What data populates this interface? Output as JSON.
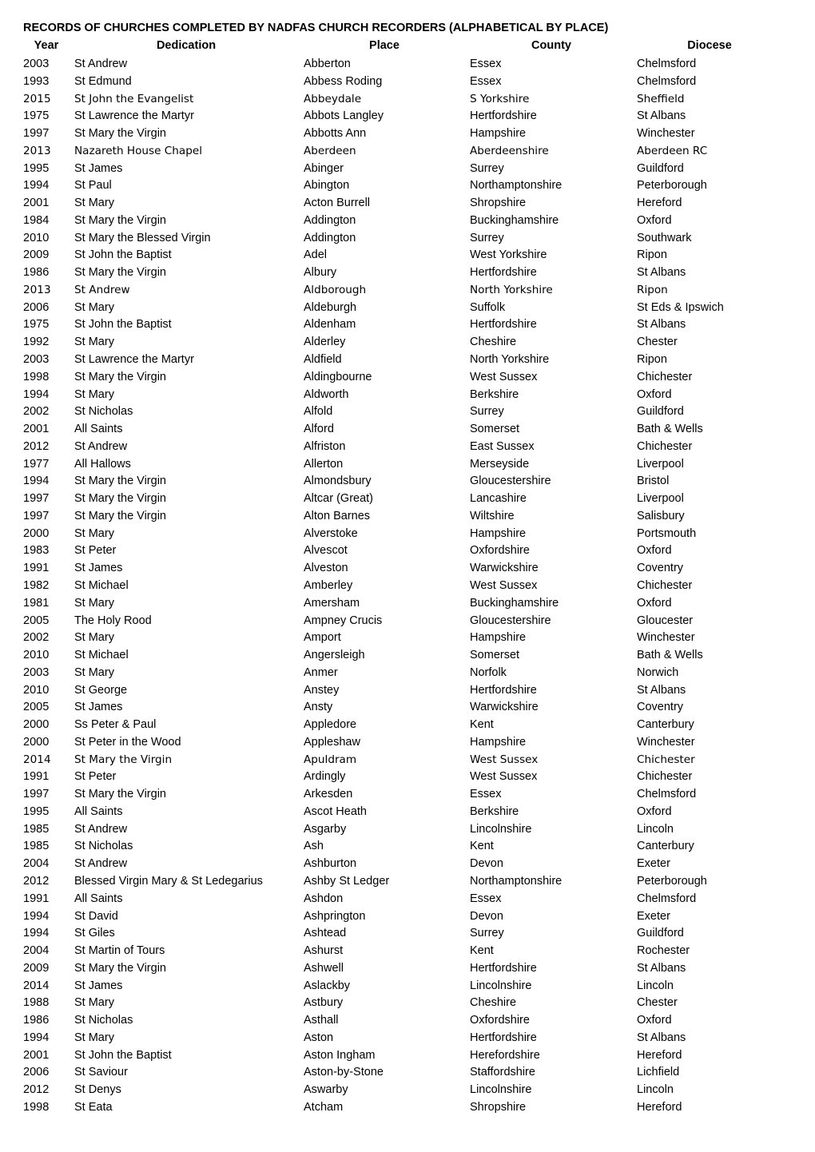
{
  "title": "RECORDS OF CHURCHES COMPLETED BY NADFAS CHURCH RECORDERS (ALPHABETICAL BY PLACE)",
  "columns": [
    "Year",
    "Dedication",
    "Place",
    "County",
    "Diocese"
  ],
  "rows": [
    {
      "year": "2003",
      "dedication": "St Andrew",
      "place": "Abberton",
      "county": "Essex",
      "diocese": "Chelmsford"
    },
    {
      "year": "1993",
      "dedication": "St Edmund",
      "place": "Abbess Roding",
      "county": "Essex",
      "diocese": "Chelmsford"
    },
    {
      "year": "2015",
      "dedication": "St John the  Evangelist",
      "place": "Abbeydale",
      "county": "S Yorkshire",
      "diocese": "Sheffield",
      "alt_font": true
    },
    {
      "year": "1975",
      "dedication": "St Lawrence the Martyr",
      "place": "Abbots Langley",
      "county": "Hertfordshire",
      "diocese": "St Albans"
    },
    {
      "year": "1997",
      "dedication": "St Mary the Virgin",
      "place": "Abbotts Ann",
      "county": "Hampshire",
      "diocese": "Winchester"
    },
    {
      "year": "2013",
      "dedication": "Nazareth House Chapel",
      "place": "Aberdeen",
      "county": "Aberdeenshire",
      "diocese": "Aberdeen RC",
      "alt_font": true
    },
    {
      "year": "1995",
      "dedication": "St James",
      "place": "Abinger",
      "county": "Surrey",
      "diocese": "Guildford"
    },
    {
      "year": "1994",
      "dedication": "St Paul",
      "place": "Abington",
      "county": "Northamptonshire",
      "diocese": "Peterborough"
    },
    {
      "year": "2001",
      "dedication": "St Mary",
      "place": "Acton Burrell",
      "county": "Shropshire",
      "diocese": "Hereford"
    },
    {
      "year": "1984",
      "dedication": "St Mary the Virgin",
      "place": "Addington",
      "county": "Buckinghamshire",
      "diocese": "Oxford"
    },
    {
      "year": "2010",
      "dedication": "St Mary the Blessed Virgin",
      "place": "Addington",
      "county": "Surrey",
      "diocese": "Southwark"
    },
    {
      "year": "2009",
      "dedication": "St John the Baptist",
      "place": "Adel",
      "county": "West Yorkshire",
      "diocese": "Ripon"
    },
    {
      "year": "1986",
      "dedication": "St Mary the Virgin",
      "place": "Albury",
      "county": "Hertfordshire",
      "diocese": "St Albans"
    },
    {
      "year": "2013",
      "dedication": "St Andrew",
      "place": "Aldborough",
      "county": "North Yorkshire",
      "diocese": "Ripon",
      "alt_font": true
    },
    {
      "year": "2006",
      "dedication": "St Mary",
      "place": "Aldeburgh",
      "county": "Suffolk",
      "diocese": "St Eds & Ipswich"
    },
    {
      "year": "1975",
      "dedication": "St John the Baptist",
      "place": "Aldenham",
      "county": "Hertfordshire",
      "diocese": "St Albans"
    },
    {
      "year": "1992",
      "dedication": "St Mary",
      "place": "Alderley",
      "county": "Cheshire",
      "diocese": "Chester"
    },
    {
      "year": "2003",
      "dedication": "St Lawrence the Martyr",
      "place": "Aldfield",
      "county": "North Yorkshire",
      "diocese": "Ripon"
    },
    {
      "year": "1998",
      "dedication": "St Mary the Virgin",
      "place": "Aldingbourne",
      "county": "West Sussex",
      "diocese": "Chichester"
    },
    {
      "year": "1994",
      "dedication": "St Mary",
      "place": "Aldworth",
      "county": "Berkshire",
      "diocese": "Oxford"
    },
    {
      "year": "2002",
      "dedication": "St Nicholas",
      "place": "Alfold",
      "county": "Surrey",
      "diocese": "Guildford"
    },
    {
      "year": "2001",
      "dedication": "All Saints",
      "place": "Alford",
      "county": "Somerset",
      "diocese": "Bath & Wells"
    },
    {
      "year": "2012",
      "dedication": "St Andrew",
      "place": "Alfriston",
      "county": "East Sussex",
      "diocese": "Chichester"
    },
    {
      "year": "1977",
      "dedication": "All Hallows",
      "place": "Allerton",
      "county": "Merseyside",
      "diocese": "Liverpool"
    },
    {
      "year": "1994",
      "dedication": "St Mary the Virgin",
      "place": "Almondsbury",
      "county": "Gloucestershire",
      "diocese": "Bristol"
    },
    {
      "year": "1997",
      "dedication": "St Mary the Virgin",
      "place": "Altcar (Great)",
      "county": "Lancashire",
      "diocese": "Liverpool"
    },
    {
      "year": "1997",
      "dedication": "St Mary the Virgin",
      "place": "Alton Barnes",
      "county": "Wiltshire",
      "diocese": "Salisbury"
    },
    {
      "year": "2000",
      "dedication": "St Mary",
      "place": "Alverstoke",
      "county": "Hampshire",
      "diocese": "Portsmouth"
    },
    {
      "year": "1983",
      "dedication": "St Peter",
      "place": "Alvescot",
      "county": "Oxfordshire",
      "diocese": "Oxford"
    },
    {
      "year": "1991",
      "dedication": "St James",
      "place": "Alveston",
      "county": "Warwickshire",
      "diocese": "Coventry"
    },
    {
      "year": "1982",
      "dedication": "St Michael",
      "place": "Amberley",
      "county": "West Sussex",
      "diocese": "Chichester"
    },
    {
      "year": "1981",
      "dedication": "St Mary",
      "place": "Amersham",
      "county": "Buckinghamshire",
      "diocese": "Oxford"
    },
    {
      "year": "2005",
      "dedication": "The Holy Rood",
      "place": "Ampney Crucis",
      "county": "Gloucestershire",
      "diocese": "Gloucester"
    },
    {
      "year": "2002",
      "dedication": "St Mary",
      "place": "Amport",
      "county": "Hampshire",
      "diocese": "Winchester"
    },
    {
      "year": "2010",
      "dedication": "St Michael",
      "place": "Angersleigh",
      "county": "Somerset",
      "diocese": "Bath & Wells"
    },
    {
      "year": "2003",
      "dedication": "St Mary",
      "place": "Anmer",
      "county": "Norfolk",
      "diocese": "Norwich"
    },
    {
      "year": "2010",
      "dedication": "St George",
      "place": "Anstey",
      "county": "Hertfordshire",
      "diocese": "St Albans"
    },
    {
      "year": "2005",
      "dedication": "St James",
      "place": "Ansty",
      "county": "Warwickshire",
      "diocese": "Coventry"
    },
    {
      "year": "2000",
      "dedication": "Ss Peter & Paul",
      "place": "Appledore",
      "county": "Kent",
      "diocese": "Canterbury"
    },
    {
      "year": "2000",
      "dedication": "St Peter in the Wood",
      "place": "Appleshaw",
      "county": "Hampshire",
      "diocese": "Winchester"
    },
    {
      "year": "2014",
      "dedication": "St Mary the Virgin",
      "place": "Apuldram",
      "county": "West Sussex",
      "diocese": "Chichester",
      "alt_font": true
    },
    {
      "year": "1991",
      "dedication": "St Peter",
      "place": "Ardingly",
      "county": "West Sussex",
      "diocese": "Chichester"
    },
    {
      "year": "1997",
      "dedication": "St Mary the Virgin",
      "place": "Arkesden",
      "county": "Essex",
      "diocese": "Chelmsford"
    },
    {
      "year": "1995",
      "dedication": "All Saints",
      "place": "Ascot Heath",
      "county": "Berkshire",
      "diocese": "Oxford"
    },
    {
      "year": "1985",
      "dedication": "St Andrew",
      "place": "Asgarby",
      "county": "Lincolnshire",
      "diocese": "Lincoln"
    },
    {
      "year": "1985",
      "dedication": "St Nicholas",
      "place": "Ash",
      "county": "Kent",
      "diocese": "Canterbury"
    },
    {
      "year": "2004",
      "dedication": "St Andrew",
      "place": "Ashburton",
      "county": "Devon",
      "diocese": "Exeter"
    },
    {
      "year": "2012",
      "dedication": "Blessed Virgin Mary & St Ledegarius",
      "place": "Ashby St Ledger",
      "county": "Northamptonshire",
      "diocese": "Peterborough"
    },
    {
      "year": "1991",
      "dedication": "All Saints",
      "place": "Ashdon",
      "county": "Essex",
      "diocese": "Chelmsford"
    },
    {
      "year": "1994",
      "dedication": "St David",
      "place": "Ashprington",
      "county": "Devon",
      "diocese": "Exeter"
    },
    {
      "year": "1994",
      "dedication": "St Giles",
      "place": "Ashtead",
      "county": "Surrey",
      "diocese": "Guildford"
    },
    {
      "year": "2004",
      "dedication": "St Martin of Tours",
      "place": "Ashurst",
      "county": "Kent",
      "diocese": "Rochester"
    },
    {
      "year": "2009",
      "dedication": "St Mary the Virgin",
      "place": "Ashwell",
      "county": "Hertfordshire",
      "diocese": "St Albans"
    },
    {
      "year": "2014",
      "dedication": "St James",
      "place": "Aslackby",
      "county": "Lincolnshire",
      "diocese": "Lincoln"
    },
    {
      "year": "1988",
      "dedication": "St Mary",
      "place": "Astbury",
      "county": "Cheshire",
      "diocese": "Chester"
    },
    {
      "year": "1986",
      "dedication": "St Nicholas",
      "place": "Asthall",
      "county": "Oxfordshire",
      "diocese": "Oxford"
    },
    {
      "year": "1994",
      "dedication": "St Mary",
      "place": "Aston",
      "county": "Hertfordshire",
      "diocese": "St Albans"
    },
    {
      "year": "2001",
      "dedication": "St John the Baptist",
      "place": "Aston Ingham",
      "county": "Herefordshire",
      "diocese": "Hereford"
    },
    {
      "year": "2006",
      "dedication": "St Saviour",
      "place": "Aston-by-Stone",
      "county": "Staffordshire",
      "diocese": "Lichfield"
    },
    {
      "year": "2012",
      "dedication": "St Denys",
      "place": "Aswarby",
      "county": "Lincolnshire",
      "diocese": "Lincoln"
    },
    {
      "year": "1998",
      "dedication": "St Eata",
      "place": "Atcham",
      "county": "Shropshire",
      "diocese": "Hereford"
    }
  ]
}
